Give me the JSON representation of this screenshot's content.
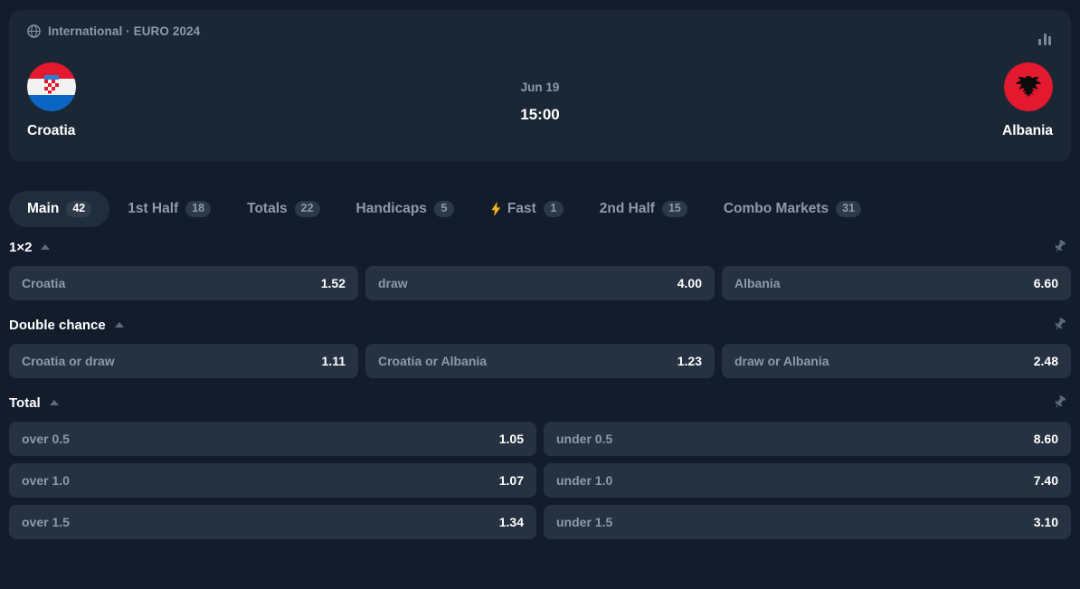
{
  "header": {
    "league": "International · EURO 2024",
    "globe_icon": "globe-icon",
    "stats_icon": "bar-chart-icon",
    "date": "Jun 19",
    "time": "15:00",
    "home_team": "Croatia",
    "away_team": "Albania"
  },
  "tabs": [
    {
      "label": "Main",
      "count": "42",
      "active": true,
      "icon": null
    },
    {
      "label": "1st Half",
      "count": "18",
      "active": false,
      "icon": null
    },
    {
      "label": "Totals",
      "count": "22",
      "active": false,
      "icon": null
    },
    {
      "label": "Handicaps",
      "count": "5",
      "active": false,
      "icon": null
    },
    {
      "label": "Fast",
      "count": "1",
      "active": false,
      "icon": "lightning-bolt-icon"
    },
    {
      "label": "2nd Half",
      "count": "15",
      "active": false,
      "icon": null
    },
    {
      "label": "Combo Markets",
      "count": "31",
      "active": false,
      "icon": null
    }
  ],
  "sections": [
    {
      "title": "1×2",
      "collapse_icon": "caret-up-icon",
      "pin_icon": "pin-icon",
      "rows": [
        [
          {
            "label": "Croatia",
            "odds": "1.52"
          },
          {
            "label": "draw",
            "odds": "4.00"
          },
          {
            "label": "Albania",
            "odds": "6.60"
          }
        ]
      ]
    },
    {
      "title": "Double chance",
      "collapse_icon": "caret-up-icon",
      "pin_icon": "pin-icon",
      "rows": [
        [
          {
            "label": "Croatia or draw",
            "odds": "1.11"
          },
          {
            "label": "Croatia or Albania",
            "odds": "1.23"
          },
          {
            "label": "draw or Albania",
            "odds": "2.48"
          }
        ]
      ]
    },
    {
      "title": "Total",
      "collapse_icon": "caret-up-icon",
      "pin_icon": "pin-icon",
      "rows": [
        [
          {
            "label": "over 0.5",
            "odds": "1.05"
          },
          {
            "label": "under 0.5",
            "odds": "8.60"
          }
        ],
        [
          {
            "label": "over 1.0",
            "odds": "1.07"
          },
          {
            "label": "under 1.0",
            "odds": "7.40"
          }
        ],
        [
          {
            "label": "over 1.5",
            "odds": "1.34"
          },
          {
            "label": "under 1.5",
            "odds": "3.10"
          }
        ]
      ]
    }
  ],
  "colors": {
    "page_background": "#131c2b",
    "card_background": "#1c2735",
    "cell_background": "#263241",
    "muted_text": "#8e9aab",
    "primary_text": "#ffffff",
    "accent_bolt": "#f5b516"
  }
}
